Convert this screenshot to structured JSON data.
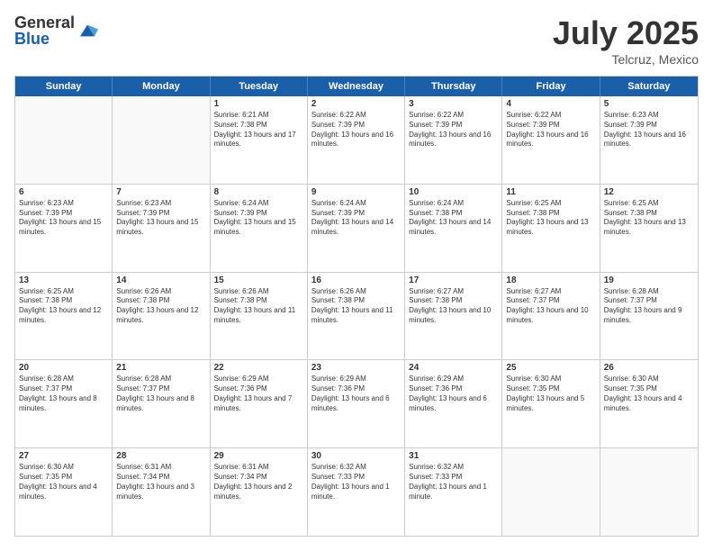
{
  "header": {
    "logo_general": "General",
    "logo_blue": "Blue",
    "month_title": "July 2025",
    "location": "Telcruz, Mexico"
  },
  "days_of_week": [
    "Sunday",
    "Monday",
    "Tuesday",
    "Wednesday",
    "Thursday",
    "Friday",
    "Saturday"
  ],
  "weeks": [
    [
      {
        "day": "",
        "empty": true
      },
      {
        "day": "",
        "empty": true
      },
      {
        "day": "1",
        "sunrise": "6:21 AM",
        "sunset": "7:38 PM",
        "daylight": "13 hours and 17 minutes."
      },
      {
        "day": "2",
        "sunrise": "6:22 AM",
        "sunset": "7:39 PM",
        "daylight": "13 hours and 16 minutes."
      },
      {
        "day": "3",
        "sunrise": "6:22 AM",
        "sunset": "7:39 PM",
        "daylight": "13 hours and 16 minutes."
      },
      {
        "day": "4",
        "sunrise": "6:22 AM",
        "sunset": "7:39 PM",
        "daylight": "13 hours and 16 minutes."
      },
      {
        "day": "5",
        "sunrise": "6:23 AM",
        "sunset": "7:39 PM",
        "daylight": "13 hours and 16 minutes."
      }
    ],
    [
      {
        "day": "6",
        "sunrise": "6:23 AM",
        "sunset": "7:39 PM",
        "daylight": "13 hours and 15 minutes."
      },
      {
        "day": "7",
        "sunrise": "6:23 AM",
        "sunset": "7:39 PM",
        "daylight": "13 hours and 15 minutes."
      },
      {
        "day": "8",
        "sunrise": "6:24 AM",
        "sunset": "7:39 PM",
        "daylight": "13 hours and 15 minutes."
      },
      {
        "day": "9",
        "sunrise": "6:24 AM",
        "sunset": "7:39 PM",
        "daylight": "13 hours and 14 minutes."
      },
      {
        "day": "10",
        "sunrise": "6:24 AM",
        "sunset": "7:38 PM",
        "daylight": "13 hours and 14 minutes."
      },
      {
        "day": "11",
        "sunrise": "6:25 AM",
        "sunset": "7:38 PM",
        "daylight": "13 hours and 13 minutes."
      },
      {
        "day": "12",
        "sunrise": "6:25 AM",
        "sunset": "7:38 PM",
        "daylight": "13 hours and 13 minutes."
      }
    ],
    [
      {
        "day": "13",
        "sunrise": "6:25 AM",
        "sunset": "7:38 PM",
        "daylight": "13 hours and 12 minutes."
      },
      {
        "day": "14",
        "sunrise": "6:26 AM",
        "sunset": "7:38 PM",
        "daylight": "13 hours and 12 minutes."
      },
      {
        "day": "15",
        "sunrise": "6:26 AM",
        "sunset": "7:38 PM",
        "daylight": "13 hours and 11 minutes."
      },
      {
        "day": "16",
        "sunrise": "6:26 AM",
        "sunset": "7:38 PM",
        "daylight": "13 hours and 11 minutes."
      },
      {
        "day": "17",
        "sunrise": "6:27 AM",
        "sunset": "7:38 PM",
        "daylight": "13 hours and 10 minutes."
      },
      {
        "day": "18",
        "sunrise": "6:27 AM",
        "sunset": "7:37 PM",
        "daylight": "13 hours and 10 minutes."
      },
      {
        "day": "19",
        "sunrise": "6:28 AM",
        "sunset": "7:37 PM",
        "daylight": "13 hours and 9 minutes."
      }
    ],
    [
      {
        "day": "20",
        "sunrise": "6:28 AM",
        "sunset": "7:37 PM",
        "daylight": "13 hours and 8 minutes."
      },
      {
        "day": "21",
        "sunrise": "6:28 AM",
        "sunset": "7:37 PM",
        "daylight": "13 hours and 8 minutes."
      },
      {
        "day": "22",
        "sunrise": "6:29 AM",
        "sunset": "7:36 PM",
        "daylight": "13 hours and 7 minutes."
      },
      {
        "day": "23",
        "sunrise": "6:29 AM",
        "sunset": "7:36 PM",
        "daylight": "13 hours and 6 minutes."
      },
      {
        "day": "24",
        "sunrise": "6:29 AM",
        "sunset": "7:36 PM",
        "daylight": "13 hours and 6 minutes."
      },
      {
        "day": "25",
        "sunrise": "6:30 AM",
        "sunset": "7:35 PM",
        "daylight": "13 hours and 5 minutes."
      },
      {
        "day": "26",
        "sunrise": "6:30 AM",
        "sunset": "7:35 PM",
        "daylight": "13 hours and 4 minutes."
      }
    ],
    [
      {
        "day": "27",
        "sunrise": "6:30 AM",
        "sunset": "7:35 PM",
        "daylight": "13 hours and 4 minutes."
      },
      {
        "day": "28",
        "sunrise": "6:31 AM",
        "sunset": "7:34 PM",
        "daylight": "13 hours and 3 minutes."
      },
      {
        "day": "29",
        "sunrise": "6:31 AM",
        "sunset": "7:34 PM",
        "daylight": "13 hours and 2 minutes."
      },
      {
        "day": "30",
        "sunrise": "6:32 AM",
        "sunset": "7:33 PM",
        "daylight": "13 hours and 1 minute."
      },
      {
        "day": "31",
        "sunrise": "6:32 AM",
        "sunset": "7:33 PM",
        "daylight": "13 hours and 1 minute."
      },
      {
        "day": "",
        "empty": true
      },
      {
        "day": "",
        "empty": true
      }
    ]
  ]
}
